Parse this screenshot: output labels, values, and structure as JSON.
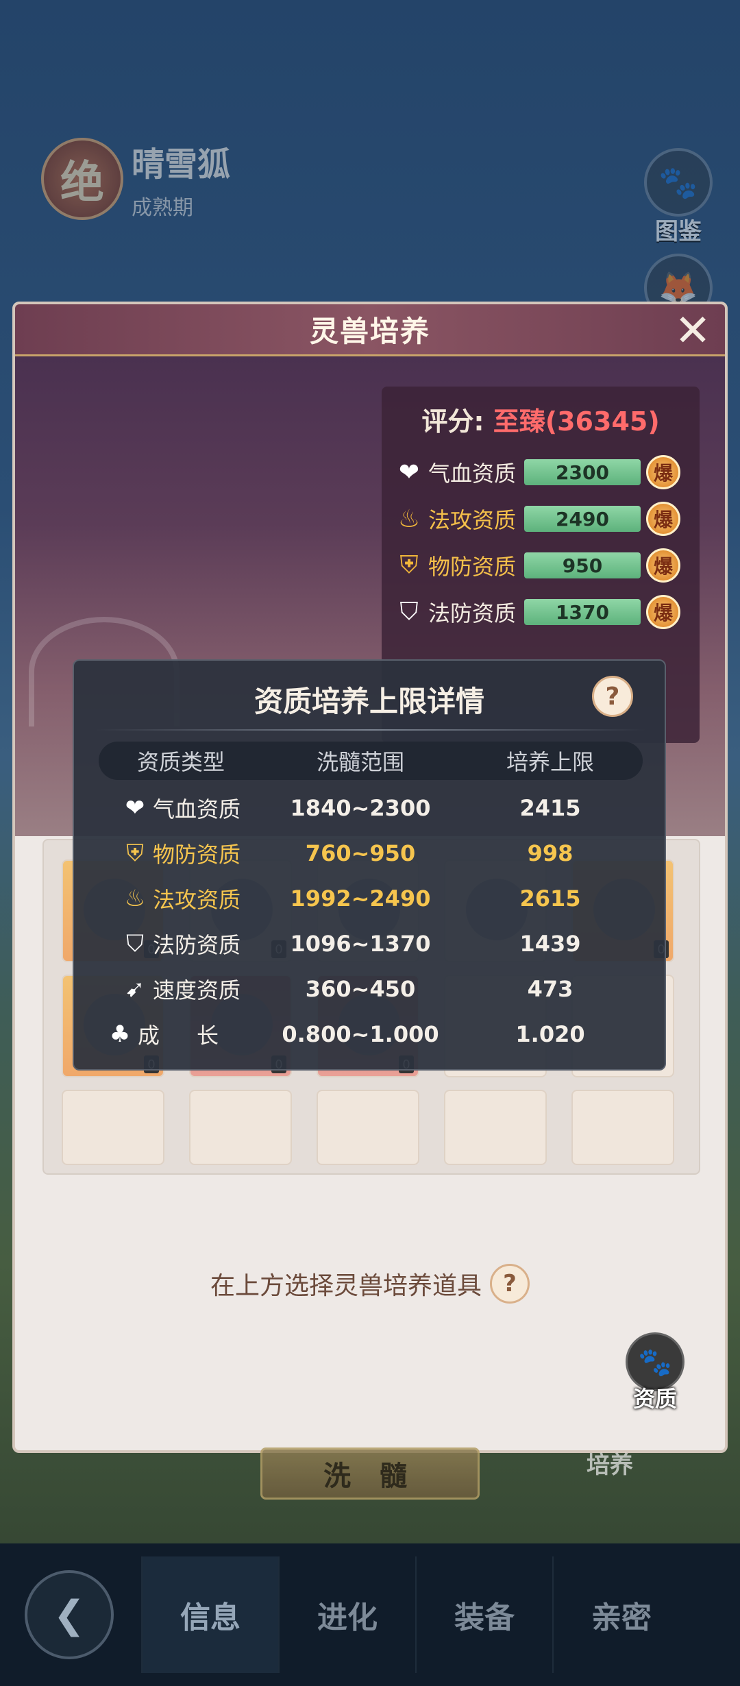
{
  "background": {
    "pet_rank_badge": "绝",
    "pet_name": "晴雪狐",
    "pet_stage": "成熟期",
    "side_buttons": [
      {
        "icon": "paw-book-icon",
        "label": "图鉴"
      }
    ],
    "bottom_nav": {
      "tabs": [
        "信息",
        "进化",
        "装备",
        "亲密"
      ],
      "active": "信息"
    },
    "wash_button": "洗 髓",
    "cultivate_tab": "培养"
  },
  "panel": {
    "title": "灵兽培养",
    "score_label": "评分:",
    "score_value": "至臻(36345)",
    "stats": [
      {
        "name": "气血资质",
        "value": "2300",
        "icon": "heart-icon",
        "burst": "爆",
        "gold": false
      },
      {
        "name": "法攻资质",
        "value": "2490",
        "icon": "flame-icon",
        "burst": "爆",
        "gold": true
      },
      {
        "name": "物防资质",
        "value": "950",
        "icon": "shield-icon",
        "burst": "爆",
        "gold": true
      },
      {
        "name": "法防资质",
        "value": "1370",
        "icon": "magic-shield-icon",
        "burst": "爆",
        "gold": false
      }
    ],
    "item_counts": [
      "0",
      "0",
      "0",
      "0",
      "0",
      "0"
    ],
    "hint": "在上方选择灵兽培养道具",
    "quality_button": "资质"
  },
  "modal": {
    "title": "资质培养上限详情",
    "headers": [
      "资质类型",
      "洗髓范围",
      "培养上限"
    ],
    "rows": [
      {
        "name": "气血资质",
        "range": "1840~2300",
        "cap": "2415",
        "icon": "heart-icon",
        "gold": false
      },
      {
        "name": "物防资质",
        "range": "760~950",
        "cap": "998",
        "icon": "shield-icon",
        "gold": true
      },
      {
        "name": "法攻资质",
        "range": "1992~2490",
        "cap": "2615",
        "icon": "flame-icon",
        "gold": true
      },
      {
        "name": "法防资质",
        "range": "1096~1370",
        "cap": "1439",
        "icon": "magic-shield-icon",
        "gold": false
      },
      {
        "name": "速度资质",
        "range": "360~450",
        "cap": "473",
        "icon": "boot-icon",
        "gold": false
      },
      {
        "name": "成长",
        "range": "0.800~1.000",
        "cap": "1.020",
        "icon": "sprout-icon",
        "gold": false
      }
    ]
  },
  "colors": {
    "gold_text": "#f6c54e",
    "score_red": "#ff6b6b",
    "stat_bar_green": "#5db27c",
    "panel_title_bg": "#7a4858"
  }
}
